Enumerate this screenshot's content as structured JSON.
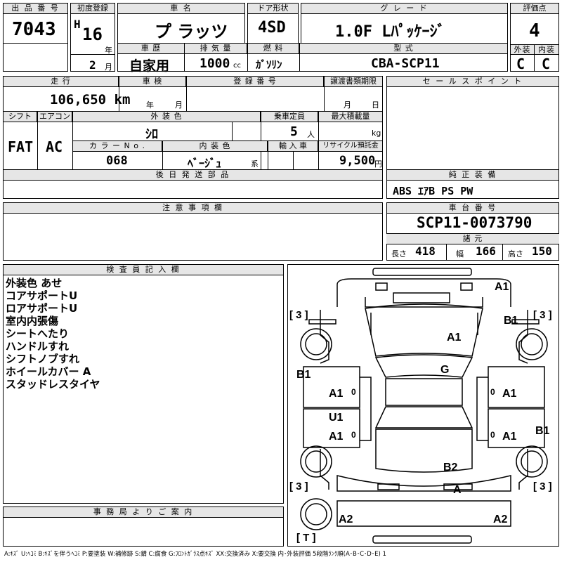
{
  "header": {
    "lot_no_label": "出 品 番 号",
    "lot_no": "7043",
    "first_reg_label": "初度登録",
    "era": "H",
    "year": "16",
    "year_unit": "年",
    "month": "2",
    "month_unit": "月",
    "car_name_label": "車 名",
    "car_name": "プ ラッツ",
    "door_label": "ドア形状",
    "door": "4SD",
    "grade_label": "グ レ ー ド",
    "grade": "1.0F Lﾊﾟｯｹｰｼﾞ",
    "score_label": "評価点",
    "score": "4",
    "history_label": "車 歴",
    "history": "自家用",
    "displacement_label": "排 気 量",
    "displacement": "1000",
    "displacement_unit": "cc",
    "fuel_label": "燃 料",
    "fuel": "ｶﾞｿﾘﾝ",
    "model_label": "型 式",
    "model": "CBA-SCP11",
    "ext_label": "外装",
    "ext_grade": "C",
    "int_label": "内装",
    "int_grade": "C"
  },
  "row2": {
    "mileage_label": "走 行",
    "mileage": "106,650 km",
    "inspection_label": "車 検",
    "insp_year_unit": "年",
    "insp_month_unit": "月",
    "reg_no_label": "登 録 番 号",
    "transfer_label": "譲渡書類期限",
    "transfer_month_unit": "月",
    "transfer_day_unit": "日",
    "shift_label": "シフト",
    "shift": "FAT",
    "ac_label": "エアコン",
    "ac": "AC",
    "color_label": "外 装 色",
    "color": "ｼﾛ",
    "capacity_label": "乗車定員",
    "capacity": "5",
    "capacity_unit": "人",
    "load_label": "最大積載量",
    "load_unit": "kg",
    "color_no_label": "カ ラ ー N o .",
    "color_no": "068",
    "int_color_label": "内 装 色",
    "int_color": "ﾍﾞｰｼﾞｭ",
    "int_color_unit": "系",
    "import_label": "輸 入 車",
    "recycle_label": "リサイクル預託金",
    "recycle": "9,500",
    "recycle_unit": "円",
    "later_parts_label": "後 日 発 送 部 品"
  },
  "sales": {
    "title": "セ ー ル ス ポ イ ン ト",
    "equip_title": "純 正 装 備",
    "equip": "ABS ｴｱB PS PW",
    "notes_title": "注 意 事 項 欄",
    "chassis_title": "車 台 番 号",
    "chassis": "SCP11-0073790",
    "dims_title": "諸 元",
    "len_label": "長さ",
    "len": "418",
    "wid_label": "幅",
    "wid": "166",
    "hgt_label": "高さ",
    "hgt": "150"
  },
  "inspector": {
    "title": "検 査 員 記 入 欄",
    "lines": [
      "外装色 あせ",
      "コアサポートU",
      "ロアサポートU",
      "室内内張傷",
      "シートへたり",
      "ハンドルすれ",
      "シフトノブすれ",
      "ホイールカバー A",
      "スタッドレスタイヤ"
    ]
  },
  "office": {
    "title": "事 務 局 よ り ご 案 内"
  },
  "diagram_marks": {
    "front_right": "A1",
    "front_r_wheel": "B1",
    "hood": "A1",
    "roof": "G",
    "left_fender": "B1",
    "l_door_f": "A1",
    "l_door_f_zero": "0",
    "r_door_f": "A1",
    "r_door_f_zero": "0",
    "l_pillar": "U1",
    "l_door_r": "A1",
    "l_door_r_zero": "0",
    "r_door_r": "A1",
    "r_door_r_zero": "0",
    "right_quarter": "B1",
    "trunk": "B2",
    "rear_plate": "A",
    "rear_left": "A2",
    "rear_right": "A2",
    "tire_fl": "[ 3 ]",
    "tire_fr": "[ 3 ]",
    "tire_rl": "[ 3 ]",
    "tire_rr": "[ 3 ]",
    "spare": "[ T ]"
  },
  "legend": "A:ｷｽﾞ U:ﾍｺﾐ B:ｷｽﾞを伴うﾍｺﾐ P:要塗装 W:補修跡 S:錆 C:腐食 G:ﾌﾛﾝﾄｶﾞﾗｽ点ｷｽﾞ XX:交換済み X:要交換 内･外装評価 5段階ﾗﾝｸ順(A･B･C･D･E) 1"
}
